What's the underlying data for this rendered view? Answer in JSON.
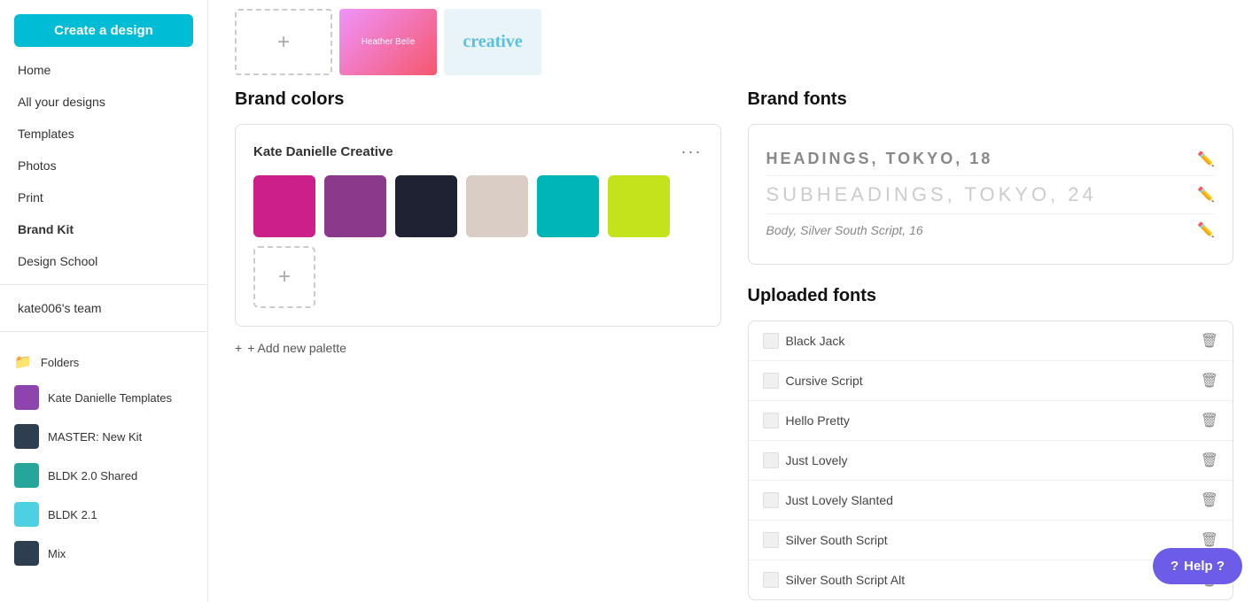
{
  "sidebar": {
    "create_button": "Create a design",
    "nav_items": [
      {
        "id": "home",
        "label": "Home"
      },
      {
        "id": "all-your-designs",
        "label": "All your designs"
      },
      {
        "id": "templates",
        "label": "Templates"
      },
      {
        "id": "photos",
        "label": "Photos"
      },
      {
        "id": "print",
        "label": "Print"
      },
      {
        "id": "brand-kit",
        "label": "Brand Kit"
      },
      {
        "id": "design-school",
        "label": "Design School"
      }
    ],
    "team_label": "kate006's team",
    "folders_label": "Folders",
    "folder_items": [
      {
        "id": "kate-danielle-templates",
        "label": "Kate Danielle Templates",
        "color": "purple"
      },
      {
        "id": "master-new-kit",
        "label": "MASTER: New Kit",
        "color": "dark"
      },
      {
        "id": "bldk-2-shared",
        "label": "BLDK 2.0 Shared",
        "color": "teal"
      },
      {
        "id": "bldk-2-1",
        "label": "BLDK 2.1",
        "color": "blue"
      },
      {
        "id": "mix",
        "label": "Mix",
        "color": "dark"
      }
    ]
  },
  "brand_colors": {
    "section_title": "Brand colors",
    "palette_name": "Kate Danielle Creative",
    "dots_label": "···",
    "swatches": [
      {
        "id": "magenta",
        "color": "#cc1f8a"
      },
      {
        "id": "purple",
        "color": "#8b3a8b"
      },
      {
        "id": "dark-navy",
        "color": "#1e2233"
      },
      {
        "id": "beige",
        "color": "#d9cdc5"
      },
      {
        "id": "teal",
        "color": "#00b5b5"
      },
      {
        "id": "lime",
        "color": "#c5e31c"
      }
    ],
    "add_color_label": "+",
    "add_palette_label": "+ Add new palette"
  },
  "brand_fonts": {
    "section_title": "Brand fonts",
    "font_rows": [
      {
        "id": "headings",
        "preview": "HEADINGS, TOKYO, 18",
        "style": "headings"
      },
      {
        "id": "subheadings",
        "preview": "SUBHEADINGS, TOKYO, 24",
        "style": "subheadings"
      },
      {
        "id": "body",
        "preview": "Body, Silver South Script, 16",
        "style": "body"
      }
    ]
  },
  "uploaded_fonts": {
    "section_title": "Uploaded fonts",
    "fonts": [
      {
        "id": "black-jack",
        "name": "Black Jack"
      },
      {
        "id": "cursive-script",
        "name": "Cursive Script"
      },
      {
        "id": "hello-pretty",
        "name": "Hello Pretty"
      },
      {
        "id": "just-lovely",
        "name": "Just Lovely"
      },
      {
        "id": "just-lovely-slanted",
        "name": "Just Lovely Slanted"
      },
      {
        "id": "silver-south-script",
        "name": "Silver South Script"
      },
      {
        "id": "silver-south-script-alt",
        "name": "Silver South Script Alt"
      }
    ]
  },
  "help_button": "Help ?",
  "images": {
    "creative_text": "creative"
  }
}
